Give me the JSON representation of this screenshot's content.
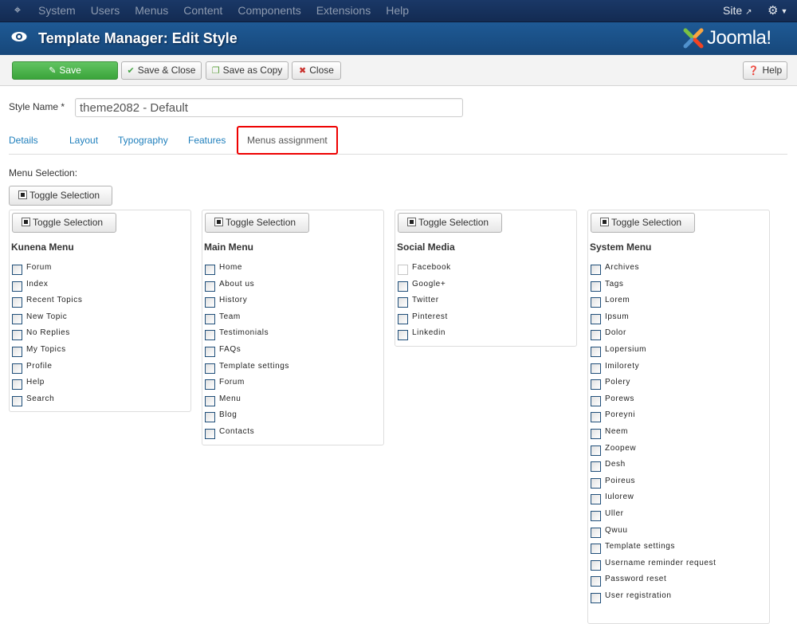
{
  "topnav": {
    "logo_icon": "joomla-x-icon",
    "menu": [
      "System",
      "Users",
      "Menus",
      "Content",
      "Components",
      "Extensions",
      "Help"
    ],
    "site_label": "Site",
    "site_icon": "external-link-icon",
    "settings_icon": "gear-icon"
  },
  "header": {
    "icon": "eye-icon",
    "title": "Template Manager: Edit Style",
    "brand": "Joomla!"
  },
  "toolbar": {
    "save": "Save",
    "save_close": "Save & Close",
    "save_copy": "Save as Copy",
    "close": "Close",
    "help": "Help",
    "save_color": "#46a546"
  },
  "form": {
    "style_name_label": "Style Name *",
    "style_name_value": "theme2082 - Default"
  },
  "tabs": [
    {
      "label": "Details",
      "active": false
    },
    {
      "label": "Layout",
      "active": false
    },
    {
      "label": "Typography",
      "active": false
    },
    {
      "label": "Features",
      "active": false
    },
    {
      "label": "Menus assignment",
      "active": true
    }
  ],
  "menu_selection": {
    "label": "Menu Selection:",
    "toggle_label": "Toggle Selection",
    "menus": [
      {
        "title": "Kunena Menu",
        "items": [
          "Forum",
          "Index",
          "Recent Topics",
          "New Topic",
          "No Replies",
          "My Topics",
          "Profile",
          "Help",
          "Search"
        ]
      },
      {
        "title": "Main Menu",
        "items": [
          "Home",
          "About us",
          "History",
          "Team",
          "Testimonials",
          "FAQs",
          "Template settings",
          "Forum",
          "Menu",
          "Blog",
          "Contacts"
        ]
      },
      {
        "title": "Social Media",
        "items": [
          "Facebook",
          "Google+",
          "Twitter",
          "Pinterest",
          "Linkedin"
        ]
      },
      {
        "title": "System Menu",
        "items": [
          "Archives",
          "Tags",
          "Lorem",
          "Ipsum",
          "Dolor",
          "Lopersium",
          "Imilorety",
          "Polery",
          "Porews",
          "Poreyni",
          "Neem",
          "Zoopew",
          "Desh",
          "Poireus",
          "Iulorew",
          "Uller",
          "Qwuu",
          "Template settings",
          "Username reminder request",
          "Password reset",
          "User registration"
        ]
      }
    ]
  }
}
